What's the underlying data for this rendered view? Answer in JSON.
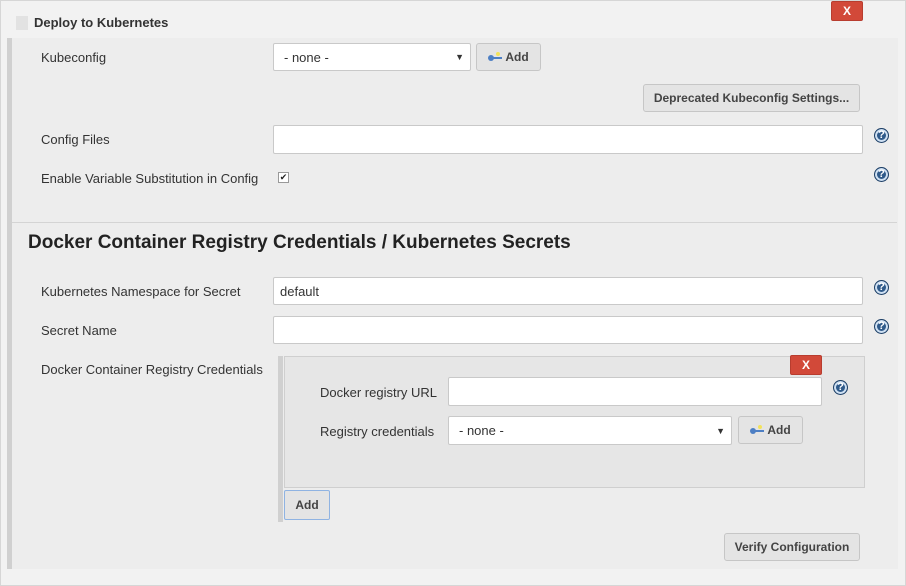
{
  "header": {
    "title": "Deploy to Kubernetes",
    "close_label": "X"
  },
  "kubeconfig": {
    "label": "Kubeconfig",
    "selected": "- none -",
    "add_label": "Add",
    "deprecated_button": "Deprecated Kubeconfig Settings..."
  },
  "config_files": {
    "label": "Config Files",
    "value": ""
  },
  "variable_substitution": {
    "label": "Enable Variable Substitution in Config",
    "checked": true,
    "check_glyph": "✔"
  },
  "secrets_section": {
    "title": "Docker Container Registry Credentials / Kubernetes Secrets",
    "namespace": {
      "label": "Kubernetes Namespace for Secret",
      "value": "default"
    },
    "secret_name": {
      "label": "Secret Name",
      "value": ""
    },
    "credentials": {
      "label": "Docker Container Registry Credentials",
      "entry": {
        "close_label": "X",
        "registry_url": {
          "label": "Docker registry URL",
          "value": ""
        },
        "registry_credentials": {
          "label": "Registry credentials",
          "selected": "- none -",
          "add_label": "Add"
        }
      },
      "add_button": "Add"
    },
    "verify_button": "Verify Configuration"
  },
  "help_glyph": "?",
  "dropdown_glyph": "▼"
}
